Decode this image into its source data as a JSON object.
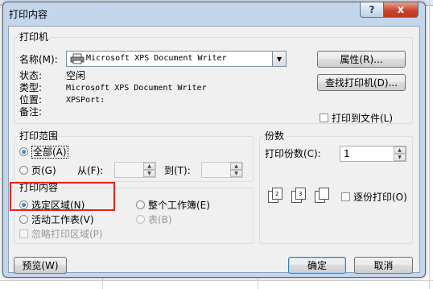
{
  "window": {
    "title": "打印内容",
    "help_glyph": "?",
    "close_glyph": "x"
  },
  "printer_group": {
    "label": "打印机",
    "name_label": "名称(M):",
    "name_value": "Microsoft XPS Document Writer",
    "status_label": "状态:",
    "status_value": "空闲",
    "type_label": "类型:",
    "type_value": "Microsoft XPS Document Writer",
    "location_label": "位置:",
    "location_value": "XPSPort:",
    "comment_label": "备注:",
    "properties_button": "属性(R)...",
    "find_printer_button": "查找打印机(D)...",
    "print_to_file_label": "打印到文件(L)"
  },
  "range_group": {
    "label": "打印范围",
    "all_label": "全部(A)",
    "pages_label": "页(G)",
    "from_label": "从(F):",
    "to_label": "到(T):"
  },
  "content_group": {
    "label": "打印内容",
    "selection_label": "选定区域(N)",
    "workbook_label": "整个工作簿(E)",
    "active_sheet_label": "活动工作表(V)",
    "table_label": "表(B)",
    "ignore_area_label": "忽略打印区域(P)"
  },
  "copies_group": {
    "label": "份数",
    "copies_label": "打印份数(C):",
    "copies_value": "1",
    "collate_label": "逐份打印(O)",
    "collate_pages": [
      "1",
      "2",
      "3"
    ]
  },
  "footer": {
    "preview_button": "预览(W)",
    "ok_button": "确定",
    "cancel_button": "取消"
  },
  "colors": {
    "highlight_border": "#e8231c",
    "dialog_frame": "#c4d6ec",
    "client_bg": "#f0f0f0"
  },
  "icons": {
    "printer": "printer-icon",
    "combo_arrow": "chevron-down-icon",
    "spin_up": "spin-up-icon",
    "spin_down": "spin-down-icon"
  }
}
